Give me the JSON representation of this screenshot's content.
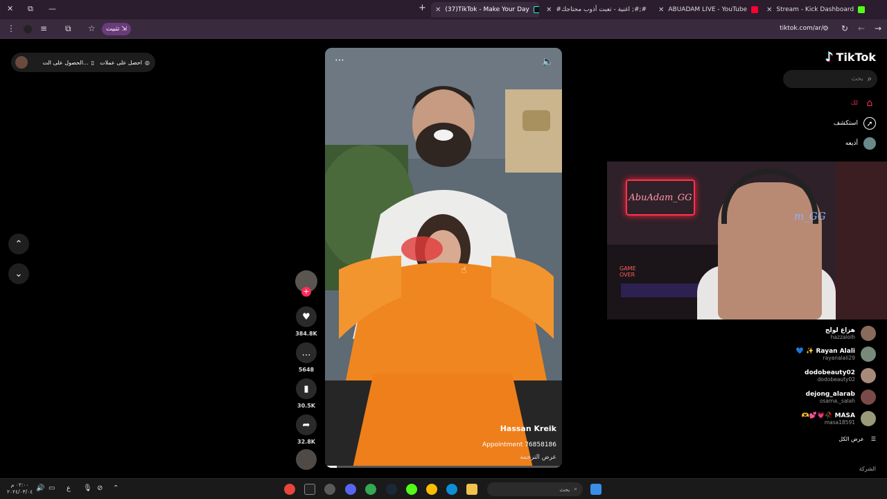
{
  "browser": {
    "tabs": [
      {
        "title": "Stream - Kick Dashboard",
        "active": false
      },
      {
        "title": "ABUADAM LIVE - YouTube",
        "active": false
      },
      {
        "title": "#اغنية - تعبت أذوب محتاجك ;#;#",
        "active": false
      },
      {
        "title": "(37)TikTok - Make Your Day",
        "active": true
      }
    ],
    "new_tab": "+",
    "url": "tiktok.com/ar/",
    "install_label": "تثبيت",
    "window_buttons": {
      "close": "✕",
      "restore": "⧉",
      "minimize": "—"
    }
  },
  "left": {
    "promo_get_coins": "احصل على عملات",
    "promo_get_app": "الحصول على الت...",
    "nav_up": "⌃",
    "nav_down": "⌄"
  },
  "video": {
    "author_name": "Hassan Kreik",
    "description": "Appointment 76858186",
    "translate": "عرض الترجمة",
    "progress": 0.05
  },
  "actions": {
    "likes": "384.8K",
    "comments": "5648",
    "saves": "30.5K",
    "shares": "32.8K"
  },
  "sidebar": {
    "logo": "TikTok",
    "search_placeholder": "بحث",
    "nav": [
      {
        "label": "لك",
        "icon": "home-icon"
      },
      {
        "label": "استكشف",
        "icon": "compass-icon"
      },
      {
        "label": "أذيعه",
        "icon": "avatar"
      }
    ]
  },
  "stream_overlay": {
    "neon_sign": "AbuAdam_GG",
    "neon_secondary": "m_GG",
    "game_over": "GAME\nOVER"
  },
  "accounts": [
    {
      "name": "هزاع لولح",
      "username": "hazzalolh",
      "color": "#8a6a5a"
    },
    {
      "name": "💙 ✨ Rayan Alali",
      "username": "rayanalali29",
      "color": "#7a8a7a"
    },
    {
      "name": "dodobeauty02",
      "username": "dodobeauty02",
      "color": "#a88a7a"
    },
    {
      "name": "dejong_alarab",
      "username": "osama._salah",
      "color": "#7a4a4a"
    },
    {
      "name": "🫶💕💗🥀 MASA",
      "username": "masa18591",
      "color": "#9a9a7a"
    }
  ],
  "see_all": "عرض الكل",
  "company": "الشركة",
  "taskbar": {
    "search_placeholder": "بحث",
    "time": "٠٢:٠٠ م",
    "date": "٢٠٢٤/٠٣/٠٤",
    "lang": "ع"
  }
}
